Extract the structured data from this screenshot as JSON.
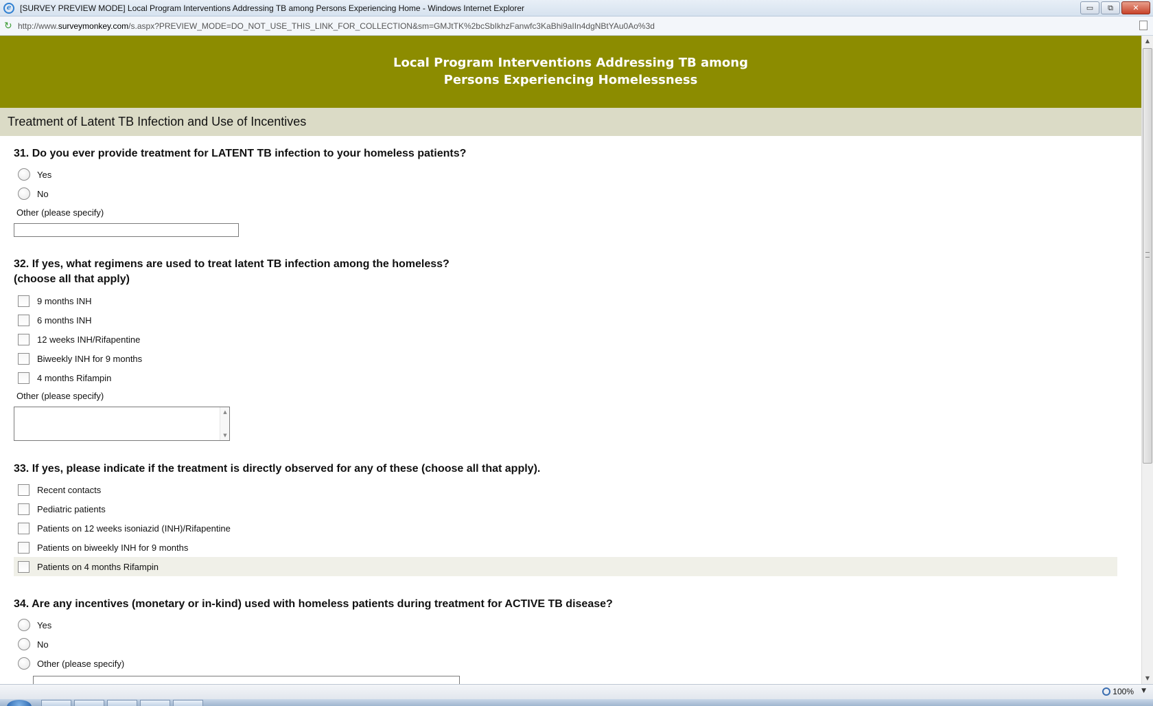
{
  "window": {
    "title": "[SURVEY PREVIEW MODE] Local Program Interventions Addressing TB among Persons Experiencing Home - Windows Internet Explorer",
    "minimize": "▭",
    "restore": "⧉",
    "close": "✕"
  },
  "address": {
    "prefix": "http://www.",
    "host": "surveymonkey.com",
    "path": "/s.aspx?PREVIEW_MODE=DO_NOT_USE_THIS_LINK_FOR_COLLECTION&sm=GMJtTK%2bcSbIkhzFanwfc3KaBhi9aIIn4dgNBtYAu0Ao%3d"
  },
  "survey": {
    "title_line1": "Local Program Interventions Addressing TB among",
    "title_line2": "Persons Experiencing Homelessness",
    "page_title": "Treatment of Latent TB Infection and Use of Incentives"
  },
  "questions": {
    "q31": {
      "title": "31. Do you ever provide treatment for LATENT TB infection to your homeless patients?",
      "options": [
        "Yes",
        "No"
      ],
      "other_label": "Other (please specify)"
    },
    "q32": {
      "title_line1": "32. If yes, what regimens are used to treat latent TB infection among the homeless?",
      "title_line2": "(choose all that apply)",
      "options": [
        "9 months INH",
        "6 months INH",
        "12 weeks INH/Rifapentine",
        "Biweekly INH for 9 months",
        "4 months Rifampin"
      ],
      "other_label": "Other (please specify)"
    },
    "q33": {
      "title": "33. If yes, please indicate if the treatment is directly observed for any of these (choose all that apply).",
      "options": [
        "Recent contacts",
        "Pediatric patients",
        "Patients on 12 weeks isoniazid (INH)/Rifapentine",
        "Patients on biweekly INH for 9 months",
        "Patients on 4 months Rifampin"
      ]
    },
    "q34": {
      "title": "34. Are any incentives (monetary or in-kind) used with homeless patients during treatment for ACTIVE TB disease?",
      "options": [
        "Yes",
        "No",
        "Other (please specify)"
      ]
    }
  },
  "status": {
    "zoom": "100%"
  },
  "icons": {
    "ie_logo": "e",
    "reload": "↻",
    "scroll_up": "▲",
    "scroll_down": "▼",
    "dropdown": "▼"
  }
}
